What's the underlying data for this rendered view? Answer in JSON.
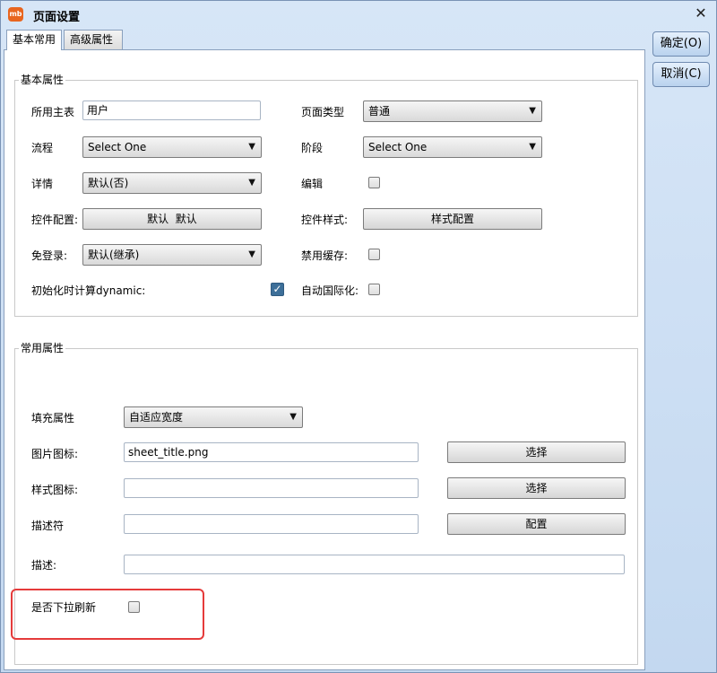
{
  "window": {
    "title": "页面设置",
    "app_icon_text": "mb",
    "close_glyph": "✕"
  },
  "tabs": [
    {
      "label": "基本常用"
    },
    {
      "label": "高级属性"
    }
  ],
  "side_buttons": {
    "ok": "确定(O)",
    "cancel": "取消(C)"
  },
  "basic": {
    "legend": "基本属性",
    "main_table": {
      "label": "所用主表",
      "value": "用户"
    },
    "page_type": {
      "label": "页面类型",
      "value": "普通"
    },
    "flow": {
      "label": "流程",
      "value": "Select One"
    },
    "stage": {
      "label": "阶段",
      "value": "Select One"
    },
    "detail": {
      "label": "详情",
      "value": "默认(否)"
    },
    "edit": {
      "label": "编辑",
      "checked": false
    },
    "control_config": {
      "label": "控件配置:",
      "button": "默认  默认"
    },
    "control_style": {
      "label": "控件样式:",
      "button": "样式配置"
    },
    "no_login": {
      "label": "免登录:",
      "value": "默认(继承)"
    },
    "disable_cache": {
      "label": "禁用缓存:",
      "checked": false
    },
    "init_dynamic": {
      "label": "初始化时计算dynamic:",
      "checked": true
    },
    "auto_i18n": {
      "label": "自动国际化:",
      "checked": false
    }
  },
  "common": {
    "legend": "常用属性",
    "fill": {
      "label": "填充属性",
      "value": "自适应宽度"
    },
    "image_icon": {
      "label": "图片图标:",
      "value": "sheet_title.png",
      "button": "选择"
    },
    "style_icon": {
      "label": "样式图标:",
      "value": "",
      "button": "选择"
    },
    "descriptor": {
      "label": "描述符",
      "value": "",
      "button": "配置"
    },
    "description": {
      "label": "描述:",
      "value": ""
    },
    "pull_refresh": {
      "label": "是否下拉刷新",
      "checked": false
    }
  }
}
